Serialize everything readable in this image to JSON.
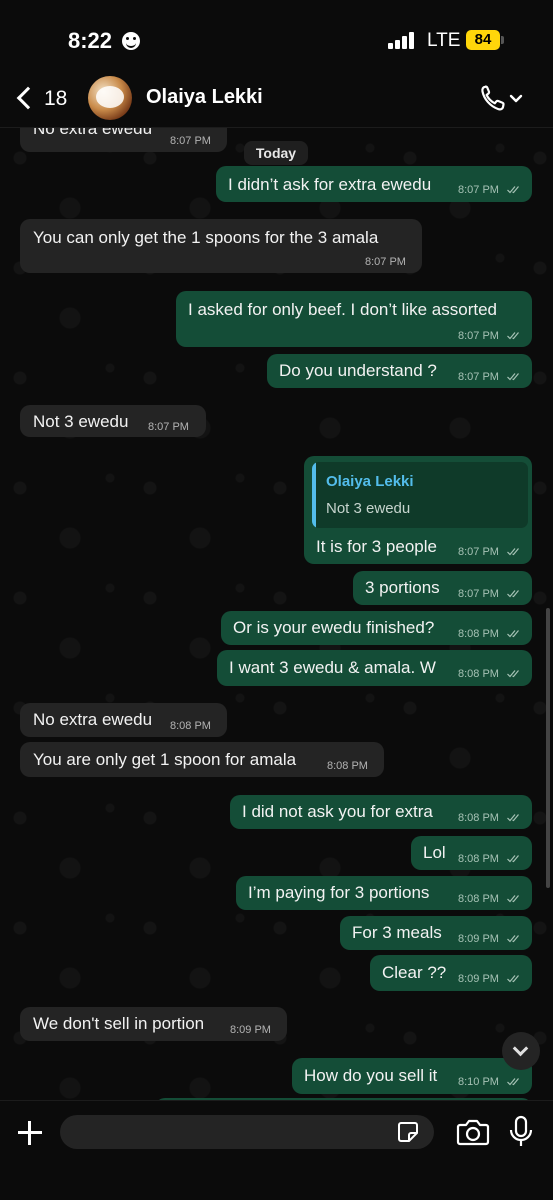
{
  "status_bar": {
    "time": "8:22",
    "network": "LTE",
    "battery": "84"
  },
  "header": {
    "back_count": "18",
    "contact_name": "Olaiya Lekki"
  },
  "chat": {
    "date_label": "Today",
    "messages": [
      {
        "dir": "in",
        "text": "No extra ewedu",
        "time": "8:07 PM"
      },
      {
        "dir": "out",
        "text": "I didn’t ask for extra ewedu",
        "time": "8:07 PM"
      },
      {
        "dir": "in",
        "text": "You can  only  get the 1 spoons for the 3 amala",
        "time": "8:07 PM"
      },
      {
        "dir": "out",
        "text": "I asked for only beef. I don’t like assorted",
        "time": "8:07 PM"
      },
      {
        "dir": "out",
        "text": "Do you understand ?",
        "time": "8:07 PM"
      },
      {
        "dir": "in",
        "text": "Not 3 ewedu",
        "time": "8:07 PM"
      },
      {
        "dir": "out",
        "text": "It is for 3 people",
        "time": "8:07 PM",
        "quote": {
          "author": "Olaiya Lekki",
          "text": "Not 3 ewedu"
        }
      },
      {
        "dir": "out",
        "text": "3 portions",
        "time": "8:07 PM"
      },
      {
        "dir": "out",
        "text": "Or is your ewedu finished?",
        "time": "8:08 PM"
      },
      {
        "dir": "out",
        "text": "I want 3 ewedu & amala. W",
        "time": "8:08 PM"
      },
      {
        "dir": "in",
        "text": "No extra ewedu",
        "time": "8:08 PM"
      },
      {
        "dir": "in",
        "text": "You  are only get 1 spoon for amala",
        "time": "8:08 PM"
      },
      {
        "dir": "out",
        "text": "I did not ask you for extra",
        "time": "8:08 PM"
      },
      {
        "dir": "out",
        "text": "Lol",
        "time": "8:08 PM"
      },
      {
        "dir": "out",
        "text": "I’m paying for 3 portions",
        "time": "8:08 PM"
      },
      {
        "dir": "out",
        "text": "For 3 meals",
        "time": "8:09 PM"
      },
      {
        "dir": "out",
        "text": "Clear ??",
        "time": "8:09 PM"
      },
      {
        "dir": "in",
        "text": "We don't sell in portion",
        "time": "8:09 PM"
      },
      {
        "dir": "out",
        "text": "How do you sell it",
        "time": "8:10 PM"
      }
    ]
  },
  "input": {
    "placeholder": ""
  },
  "colors": {
    "incoming": "#242424",
    "outgoing": "#144d37",
    "reply_accent": "#53bdeb",
    "battery": "#ffd60a"
  },
  "icons": [
    "back-chevron-icon",
    "phone-icon",
    "chevron-down-icon",
    "plus-icon",
    "sticker-icon",
    "camera-icon",
    "microphone-icon",
    "read-ticks-icon"
  ]
}
